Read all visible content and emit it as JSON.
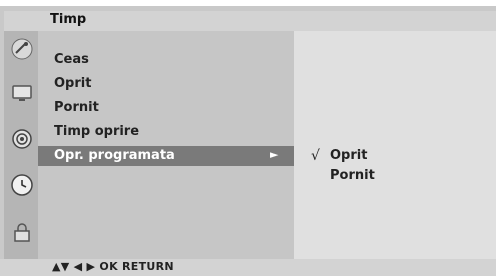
{
  "menu": {
    "title": "Timp",
    "items": [
      "Ceas",
      "Oprit",
      "Pornit",
      "Timp oprire",
      "Opr. programata"
    ],
    "selected_index": 4
  },
  "submenu": {
    "options": [
      "Oprit",
      "Pornit"
    ],
    "checked_index": 0,
    "check_glyph": "√"
  },
  "footer": {
    "nav_hint": "▲▼  ◀ ▶  OK  RETURN"
  },
  "sidebar": {
    "icons": [
      "satellite-dish-icon",
      "tv-screen-icon",
      "speaker-icon",
      "clock-icon",
      "lock-icon"
    ],
    "selected_icon_index": 3
  },
  "colors": {
    "selected_row": "#7a7a7a",
    "menu_panel": "#c6c6c6",
    "sub_panel": "#e0e0e0"
  }
}
